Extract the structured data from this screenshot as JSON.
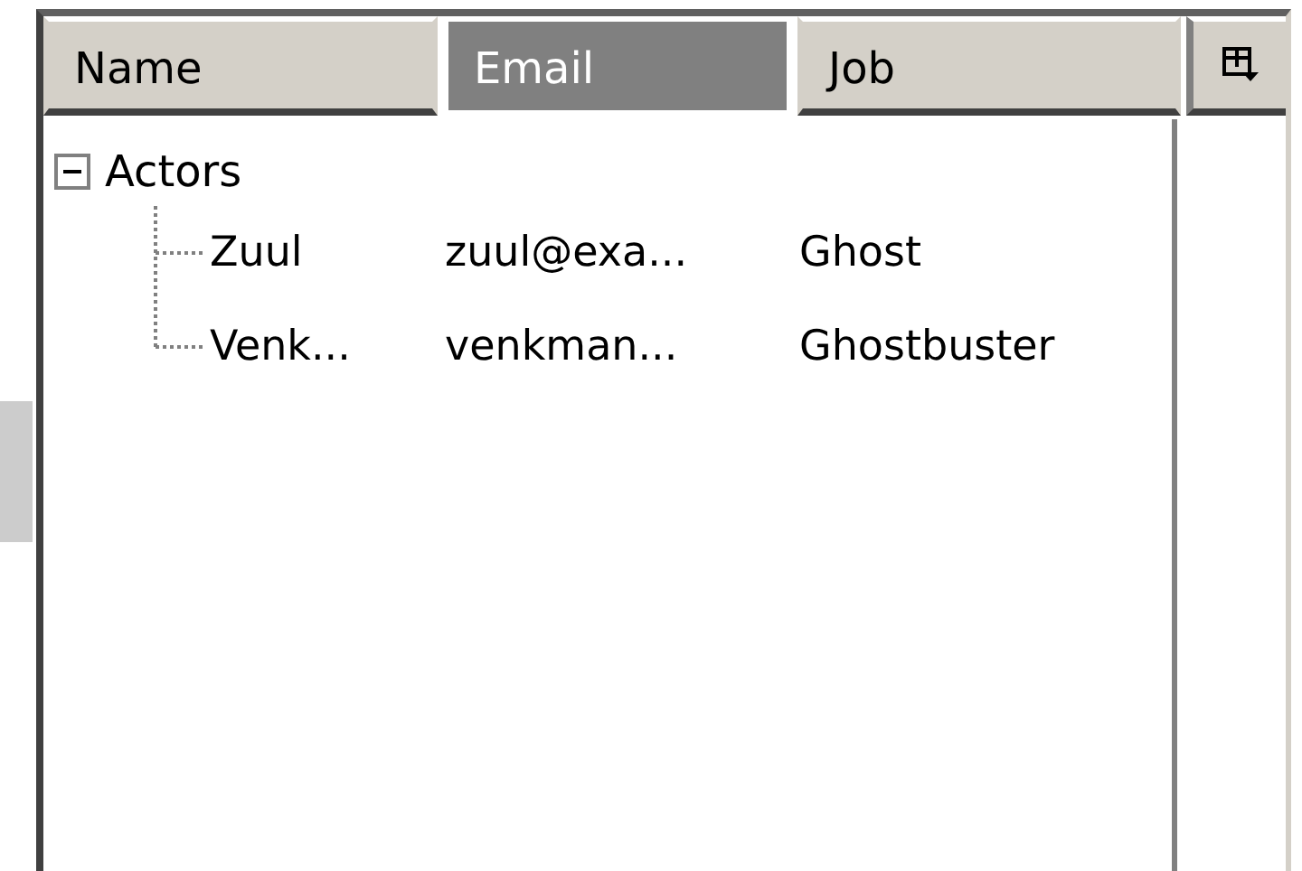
{
  "columns": [
    {
      "label": "Name",
      "selected": false
    },
    {
      "label": "Email",
      "selected": true
    },
    {
      "label": "Job",
      "selected": false
    }
  ],
  "tree": [
    {
      "label": "Actors",
      "expanded": true,
      "children": [
        {
          "cells": [
            "Zuul",
            "zuul@exa...",
            "Ghost"
          ]
        },
        {
          "cells": [
            "Venk...",
            "venkman...",
            "Ghostbuster"
          ]
        }
      ]
    }
  ]
}
